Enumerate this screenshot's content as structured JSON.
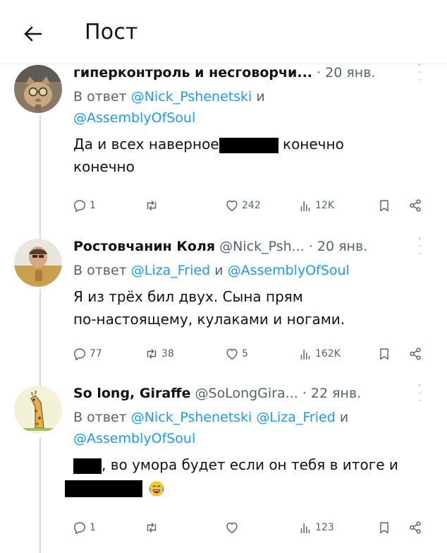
{
  "header": {
    "title": "Пост"
  },
  "posts": [
    {
      "name": "гиперконтроль и несговорчи...",
      "handle": "",
      "dot": "·",
      "time": "20 янв.",
      "reply_prefix": "В ответ",
      "mentions": [
        "@Nick_Pshenetski",
        "@AssemblyOfSoul"
      ],
      "and": "и",
      "text_a": "Да и всех наверное",
      "text_b": "конечно",
      "text_c": "конечно",
      "counts": {
        "replies": "1",
        "reposts": "",
        "likes": "242",
        "views": "12K"
      }
    },
    {
      "name": "Ростовчанин Коля",
      "handle": "@Nick_Psh...",
      "dot": "·",
      "time": "20 янв.",
      "reply_prefix": "В ответ",
      "mentions": [
        "@Liza_Fried",
        "@AssemblyOfSoul"
      ],
      "and": "и",
      "text_a": "Я из трёх бил двух. Сына прям",
      "text_b": "по-настоящему, кулаками и ногами.",
      "counts": {
        "replies": "77",
        "reposts": "38",
        "likes": "5",
        "views": "162K"
      }
    },
    {
      "name": "So long, Giraffe",
      "handle": "@SoLongGira...",
      "dot": "·",
      "time": "22 янв.",
      "reply_prefix": "В ответ",
      "mentions": [
        "@Nick_Pshenetski",
        "@Liza_Fried",
        "@AssemblyOfSoul"
      ],
      "and": "и",
      "text_a": ", во умора будет если он тебя в итоге и",
      "counts": {
        "replies": "1",
        "reposts": "",
        "likes": "",
        "views": "123"
      }
    }
  ],
  "icons": {
    "back": "arrow-left-icon",
    "reply": "speech-bubble-icon",
    "repost": "repost-arrows-icon",
    "like": "heart-icon",
    "views": "bar-chart-icon",
    "bookmark": "bookmark-icon",
    "share": "share-icon",
    "more": "three-dots-vertical-icon",
    "emoji": "tears-of-joy-emoji"
  },
  "colors": {
    "link": "#1d9bf0",
    "muted": "#536471",
    "text": "#0f1419",
    "line": "#cfd9de"
  }
}
